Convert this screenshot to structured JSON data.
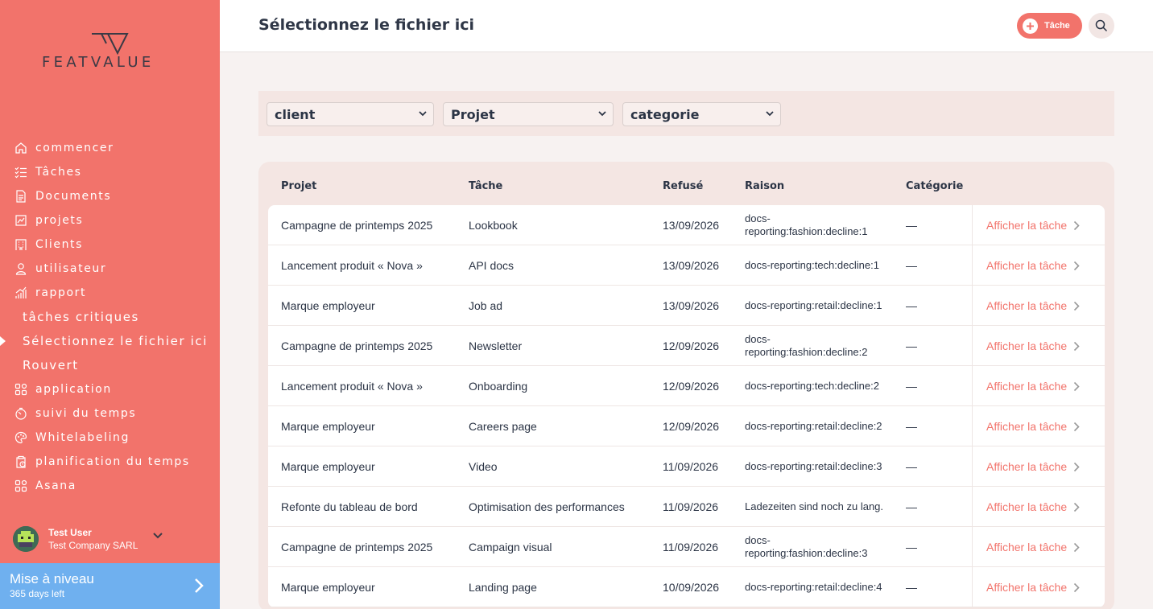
{
  "brand": {
    "name": "FEATVALUE"
  },
  "sidebar": {
    "items": [
      {
        "label": "commencer",
        "icon": "home-icon"
      },
      {
        "label": "Tâches",
        "icon": "checklist-icon"
      },
      {
        "label": "Documents",
        "icon": "documents-icon"
      },
      {
        "label": "projets",
        "icon": "chart-icon"
      },
      {
        "label": "Clients",
        "icon": "building-icon"
      },
      {
        "label": "utilisateur",
        "icon": "user-icon"
      },
      {
        "label": "rapport",
        "icon": "report-icon"
      },
      {
        "label": "tâches critiques",
        "icon": ""
      },
      {
        "label": "Sélectionnez le fichier ici",
        "icon": "",
        "active": true
      },
      {
        "label": "Rouvert",
        "icon": ""
      },
      {
        "label": "application",
        "icon": "apps-icon"
      },
      {
        "label": "suivi du temps",
        "icon": "timer-icon"
      },
      {
        "label": "Whitelabeling",
        "icon": "palette-icon"
      },
      {
        "label": "planification du temps",
        "icon": "clipboard-clock-icon"
      },
      {
        "label": "Asana",
        "icon": "apps-icon"
      }
    ],
    "user": {
      "name": "Test User",
      "company": "Test Company SARL"
    },
    "upgrade": {
      "title": "Mise à niveau",
      "subtitle": "365 days left"
    }
  },
  "header": {
    "title": "Sélectionnez le fichier ici",
    "task_button": "Tâche"
  },
  "filters": {
    "client": "client",
    "projet": "Projet",
    "categorie": "categorie"
  },
  "table": {
    "columns": [
      "Projet",
      "Tâche",
      "Refusé",
      "Raison",
      "Catégorie"
    ],
    "link_label": "Afficher la tâche",
    "rows": [
      {
        "projet": "Campagne de printemps 2025",
        "tache": "Lookbook",
        "refuse": "13/09/2026",
        "raison": "docs-reporting:fashion:decline:1",
        "categorie": "—"
      },
      {
        "projet": "Lancement produit « Nova »",
        "tache": "API docs",
        "refuse": "13/09/2026",
        "raison": "docs-reporting:tech:decline:1",
        "categorie": "—"
      },
      {
        "projet": "Marque employeur",
        "tache": "Job ad",
        "refuse": "13/09/2026",
        "raison": "docs-reporting:retail:decline:1",
        "categorie": "—"
      },
      {
        "projet": "Campagne de printemps 2025",
        "tache": "Newsletter",
        "refuse": "12/09/2026",
        "raison": "docs-reporting:fashion:decline:2",
        "categorie": "—"
      },
      {
        "projet": "Lancement produit « Nova »",
        "tache": "Onboarding",
        "refuse": "12/09/2026",
        "raison": "docs-reporting:tech:decline:2",
        "categorie": "—"
      },
      {
        "projet": "Marque employeur",
        "tache": "Careers page",
        "refuse": "12/09/2026",
        "raison": "docs-reporting:retail:decline:2",
        "categorie": "—"
      },
      {
        "projet": "Marque employeur",
        "tache": "Video",
        "refuse": "11/09/2026",
        "raison": "docs-reporting:retail:decline:3",
        "categorie": "—"
      },
      {
        "projet": "Refonte du tableau de bord",
        "tache": "Optimisation des performances",
        "refuse": "11/09/2026",
        "raison": "Ladezeiten sind noch zu lang.",
        "categorie": "—"
      },
      {
        "projet": "Campagne de printemps 2025",
        "tache": "Campaign visual",
        "refuse": "11/09/2026",
        "raison": "docs-reporting:fashion:decline:3",
        "categorie": "—"
      },
      {
        "projet": "Marque employeur",
        "tache": "Landing page",
        "refuse": "10/09/2026",
        "raison": "docs-reporting:retail:decline:4",
        "categorie": "—"
      }
    ]
  },
  "colors": {
    "accent": "#f2736b",
    "upgrade": "#6fb0ef",
    "text": "#2b3445"
  }
}
